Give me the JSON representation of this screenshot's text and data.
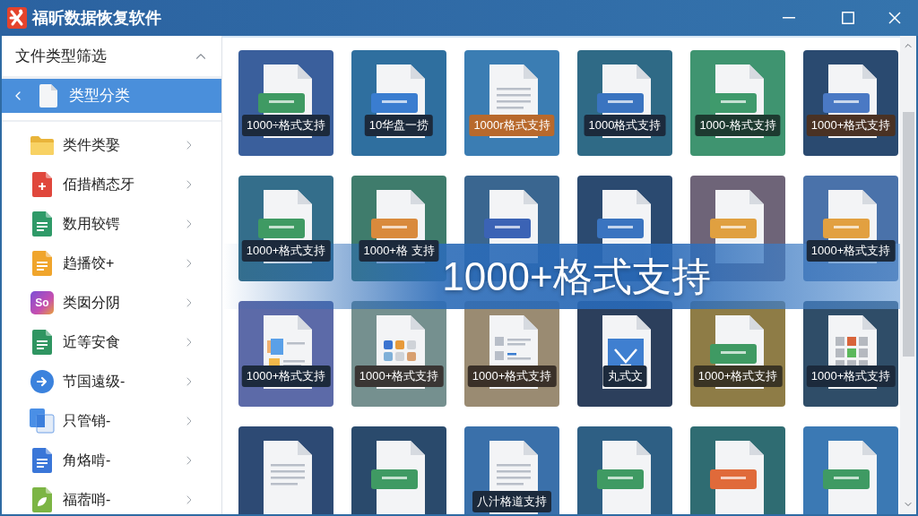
{
  "window": {
    "title": "福昕数据恢复软件"
  },
  "sidebar": {
    "title": "文件类型筛选",
    "expanded": true,
    "current": {
      "label": "类型分类",
      "selected": true
    },
    "items": [
      {
        "label": "类件类娶",
        "selected": false
      },
      {
        "label": "佰措楢态牙",
        "selected": false
      },
      {
        "label": "数用较锷",
        "selected": false
      },
      {
        "label": "趋播饺+",
        "selected": false
      },
      {
        "label": "类囡分阴",
        "icon_text": "So",
        "selected": false
      },
      {
        "label": "近等安食",
        "selected": false
      },
      {
        "label": "节国遠级-",
        "selected": false
      },
      {
        "label": "只管销-",
        "selected": false
      },
      {
        "label": "角烙啃-",
        "selected": false
      },
      {
        "label": "福蓿哨-",
        "selected": false
      }
    ]
  },
  "tiles": [
    {
      "kind": "tag",
      "label": "1000÷格式支持"
    },
    {
      "kind": "tag",
      "label": "10华盘一捞"
    },
    {
      "kind": "lines",
      "label": "1000r格式支持"
    },
    {
      "kind": "tag",
      "label": "1000格式支持"
    },
    {
      "kind": "tag",
      "label": "1000-格式支持"
    },
    {
      "kind": "tag",
      "label": "1000+格式支持"
    },
    {
      "kind": "tag",
      "label": "1000+格式支持"
    },
    {
      "kind": "tag",
      "label": "1000+格 支持"
    },
    {
      "kind": "tag"
    },
    {
      "kind": "tag"
    },
    {
      "kind": "tag"
    },
    {
      "kind": "tag",
      "label": "1000+格式支持"
    },
    {
      "kind": "media",
      "label": "1000+格式支持"
    },
    {
      "kind": "apps",
      "label": "1000+格式支持"
    },
    {
      "kind": "list",
      "label": "1000+格式支持"
    },
    {
      "kind": "picture",
      "label": "丸式文"
    },
    {
      "kind": "tag",
      "label": "1000+格式支持"
    },
    {
      "kind": "grid",
      "label": "1000+格式支持"
    },
    {
      "kind": "lines"
    },
    {
      "kind": "tag"
    },
    {
      "kind": "lines",
      "label": "八汁格道支持"
    },
    {
      "kind": "tag"
    },
    {
      "kind": "tag"
    },
    {
      "kind": "tag"
    }
  ],
  "banner": {
    "text": "1000+格式支持"
  }
}
